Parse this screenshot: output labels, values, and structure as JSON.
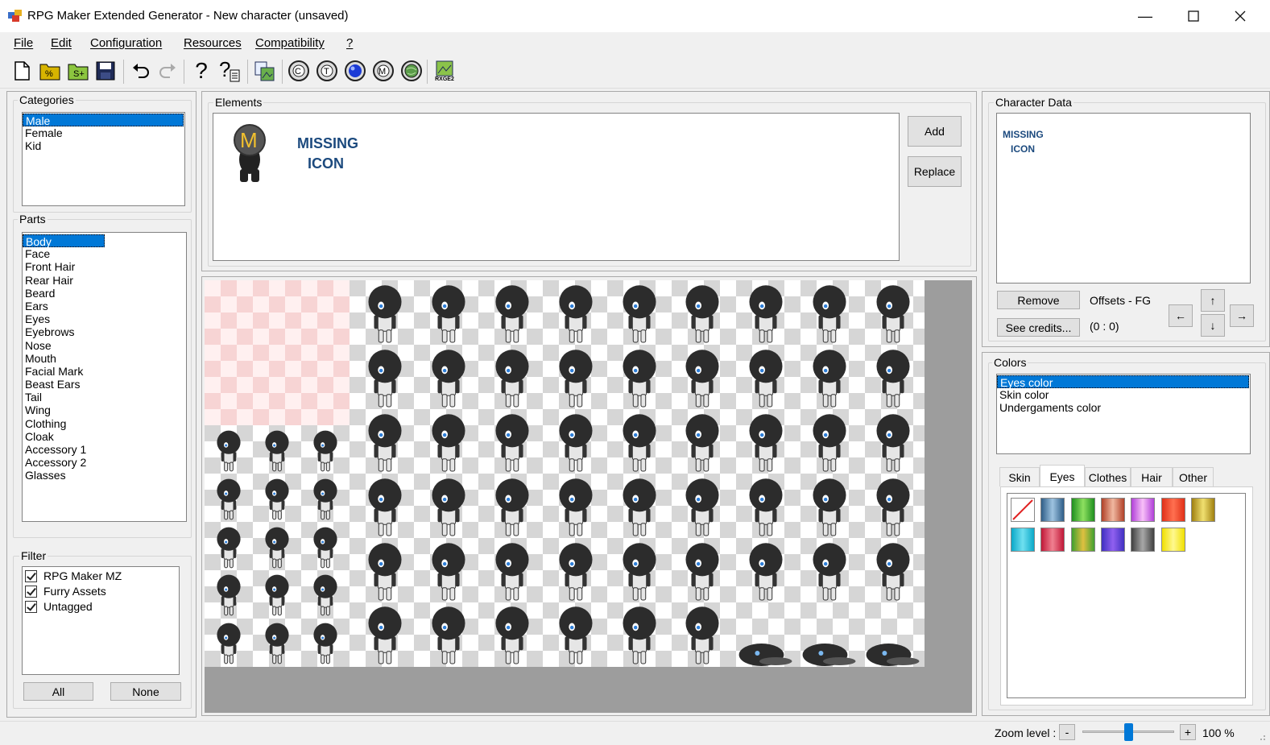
{
  "window": {
    "title": "RPG Maker Extended Generator - New character (unsaved)"
  },
  "menu": [
    "File",
    "Edit",
    "Configuration",
    "Resources",
    "Compatibility",
    "?"
  ],
  "toolbar": {
    "icons": [
      "new-file-icon",
      "open-generator-icon",
      "open-s-icon",
      "save-icon",
      "undo-icon",
      "redo-icon",
      "help-icon",
      "help-docs-icon",
      "export-image-icon",
      "copyright-icon",
      "t-circle-icon",
      "blue-orb-icon",
      "m-circle-icon",
      "world-icon",
      "rxge2-icon"
    ],
    "rxge2_label": "RXGE2"
  },
  "categories": {
    "legend": "Categories",
    "items": [
      "Male",
      "Female",
      "Kid"
    ],
    "selected": "Male"
  },
  "parts": {
    "legend": "Parts",
    "items": [
      "Body",
      "Face",
      "Front Hair",
      "Rear Hair",
      "Beard",
      "Ears",
      "Eyes",
      "Eyebrows",
      "Nose",
      "Mouth",
      "Facial Mark",
      "Beast Ears",
      "Tail",
      "Wing",
      "Clothing",
      "Cloak",
      "Accessory 1",
      "Accessory 2",
      "Glasses"
    ],
    "selected": "Body"
  },
  "filter": {
    "legend": "Filter",
    "items": [
      {
        "label": "RPG Maker MZ",
        "checked": true
      },
      {
        "label": "Furry Assets",
        "checked": true
      },
      {
        "label": "Untagged",
        "checked": true
      }
    ],
    "all_label": "All",
    "none_label": "None"
  },
  "elements": {
    "legend": "Elements",
    "missing_letter": "M",
    "missing_line1": "MISSING",
    "missing_line2": "ICON",
    "add_label": "Add",
    "replace_label": "Replace"
  },
  "character_data": {
    "legend": "Character Data",
    "missing_line1": "MISSING",
    "missing_line2": "ICON",
    "remove_label": "Remove",
    "see_credits_label": "See credits...",
    "offsets_label": "Offsets - FG",
    "offsets_value": "(0 : 0)",
    "arrow_up": "↑",
    "arrow_down": "↓",
    "arrow_left": "←",
    "arrow_right": "→"
  },
  "colors": {
    "legend": "Colors",
    "items": [
      "Eyes color",
      "Skin color",
      "Undergaments color"
    ],
    "selected": "Eyes color",
    "tabs": [
      "Skin",
      "Eyes",
      "Clothes",
      "Hair",
      "Other"
    ],
    "active_tab": "Eyes",
    "swatches": [
      [
        "#ffffff",
        "#ffffff"
      ],
      [
        "#2f5e88",
        "#9ec3e0"
      ],
      [
        "#1f8f1f",
        "#8ee060"
      ],
      [
        "#b04028",
        "#f0b8a0"
      ],
      [
        "#b040d8",
        "#f8c0f8"
      ],
      [
        "#e03018",
        "#ff7050"
      ],
      [
        "#a08010",
        "#f0e070"
      ],
      [
        "#0aa8c8",
        "#70e0f0"
      ],
      [
        "#c01838",
        "#f08090"
      ],
      [
        "#40a030",
        "#e0c040"
      ],
      [
        "#4030c0",
        "#9060f0"
      ],
      [
        "#404040",
        "#a8a8a8"
      ],
      [
        "#f0e000",
        "#fff890"
      ]
    ]
  },
  "status": {
    "zoom_label": "Zoom level :",
    "zoom_minus": "-",
    "zoom_plus": "+",
    "zoom_value": "100 %",
    "zoom_level": 0.5
  }
}
